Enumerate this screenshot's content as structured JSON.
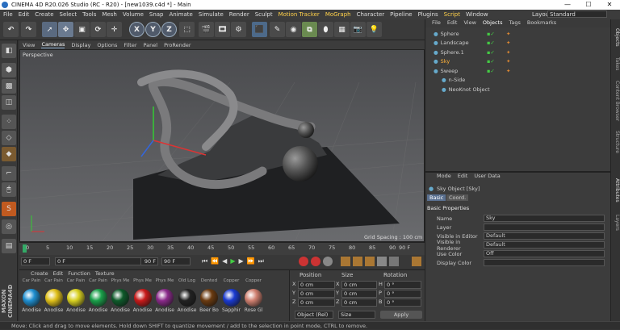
{
  "window": {
    "title": "CINEMA 4D R20.026 Studio (RC - R20) - [new1039.c4d *] - Main",
    "min": "—",
    "max": "☐",
    "close": "✕"
  },
  "menu": [
    "File",
    "Edit",
    "Create",
    "Select",
    "Tools",
    "Mesh",
    "Volume",
    "Snap",
    "Animate",
    "Simulate",
    "Render",
    "Sculpt",
    "Motion Tracker",
    "MoGraph",
    "Character",
    "Pipeline",
    "Plugins",
    "Script",
    "Window"
  ],
  "layout": {
    "label": "Layout:",
    "value": "Standard"
  },
  "toolbar": {
    "x": "X",
    "y": "Y",
    "z": "Z"
  },
  "viewport": {
    "label": "Perspective",
    "menu": [
      "View",
      "Cameras",
      "Display",
      "Options",
      "Filter",
      "Panel",
      "ProRender"
    ],
    "grid_spacing": "Grid Spacing : 100 cm"
  },
  "timeline": {
    "ticks": [
      "0",
      "5",
      "10",
      "15",
      "20",
      "25",
      "30",
      "35",
      "40",
      "45",
      "50",
      "55",
      "60",
      "65",
      "70",
      "75",
      "80",
      "85",
      "90"
    ],
    "frame_end": "90 F"
  },
  "transport": {
    "current": "0 F",
    "start": "0 F",
    "end": "90 F",
    "end2": "90 F"
  },
  "materials": {
    "menu": [
      "Create",
      "Edit",
      "Function",
      "Texture"
    ],
    "top_labels": [
      "Car Pain",
      "Car Pain",
      "Car Pain",
      "Car Pain",
      "Phys Me",
      "Phys Me",
      "Phys Me",
      "Old Log",
      "Dented",
      "Copper",
      "Copper"
    ],
    "items": [
      {
        "label": "Anodise",
        "color": "#1f8fd0"
      },
      {
        "label": "Anodise",
        "color": "#e0c01a"
      },
      {
        "label": "Anodise",
        "color": "#d8d020"
      },
      {
        "label": "Anodise",
        "color": "#1aa04a"
      },
      {
        "label": "Anodise",
        "color": "#0e5a2a"
      },
      {
        "label": "Anodise",
        "color": "#c81a1a"
      },
      {
        "label": "Anodise",
        "color": "#8a2a8a"
      },
      {
        "label": "Anodise",
        "color": "#222222"
      },
      {
        "label": "Beer Bo",
        "color": "#6a3a10"
      },
      {
        "label": "Sapphir",
        "color": "#1a3ad0"
      },
      {
        "label": "Rose Gl",
        "color": "#d08070"
      }
    ]
  },
  "coords": {
    "headers": [
      "Position",
      "Size",
      "Rotation"
    ],
    "rows": [
      {
        "axis": "X",
        "pos": "0 cm",
        "size": "0 cm",
        "rot_label": "H",
        "rot": "0 °"
      },
      {
        "axis": "Y",
        "pos": "0 cm",
        "size": "0 cm",
        "rot_label": "P",
        "rot": "0 °"
      },
      {
        "axis": "Z",
        "pos": "0 cm",
        "size": "0 cm",
        "rot_label": "B",
        "rot": "0 °"
      }
    ],
    "mode": "Object (Rel)",
    "size_mode": "Size",
    "apply": "Apply"
  },
  "objects": {
    "menu": [
      "File",
      "Edit",
      "View",
      "Objects",
      "Tags",
      "Bookmarks"
    ],
    "items": [
      {
        "name": "Sphere",
        "indent": 0,
        "selected": false
      },
      {
        "name": "Landscape",
        "indent": 0,
        "selected": false
      },
      {
        "name": "Sphere.1",
        "indent": 0,
        "selected": false
      },
      {
        "name": "Sky",
        "indent": 0,
        "selected": true
      },
      {
        "name": "Sweep",
        "indent": 0,
        "selected": false
      },
      {
        "name": "n-Side",
        "indent": 1,
        "selected": false
      },
      {
        "name": "NeoKnot Object",
        "indent": 1,
        "selected": false
      }
    ]
  },
  "attributes": {
    "menu": [
      "Mode",
      "Edit",
      "User Data"
    ],
    "object_title": "Sky Object [Sky]",
    "tabs": [
      "Basic",
      "Coord."
    ],
    "section": "Basic Properties",
    "fields": [
      {
        "label": "Name",
        "value": "Sky"
      },
      {
        "label": "Layer",
        "value": ""
      },
      {
        "label": "Visible in Editor",
        "value": "Default"
      },
      {
        "label": "Visible in Renderer",
        "value": "Default"
      },
      {
        "label": "Use Color",
        "value": "Off"
      },
      {
        "label": "Display Color",
        "value": ""
      }
    ]
  },
  "right_tabs": [
    "Objects",
    "Takes",
    "Content Browser",
    "Structure",
    "Attributes",
    "Layers"
  ],
  "left_brand": "MAXON CINEMA4D",
  "status": "Move: Click and drag to move elements. Hold down SHIFT to quantize movement / add to the selection in point mode, CTRL to remove."
}
